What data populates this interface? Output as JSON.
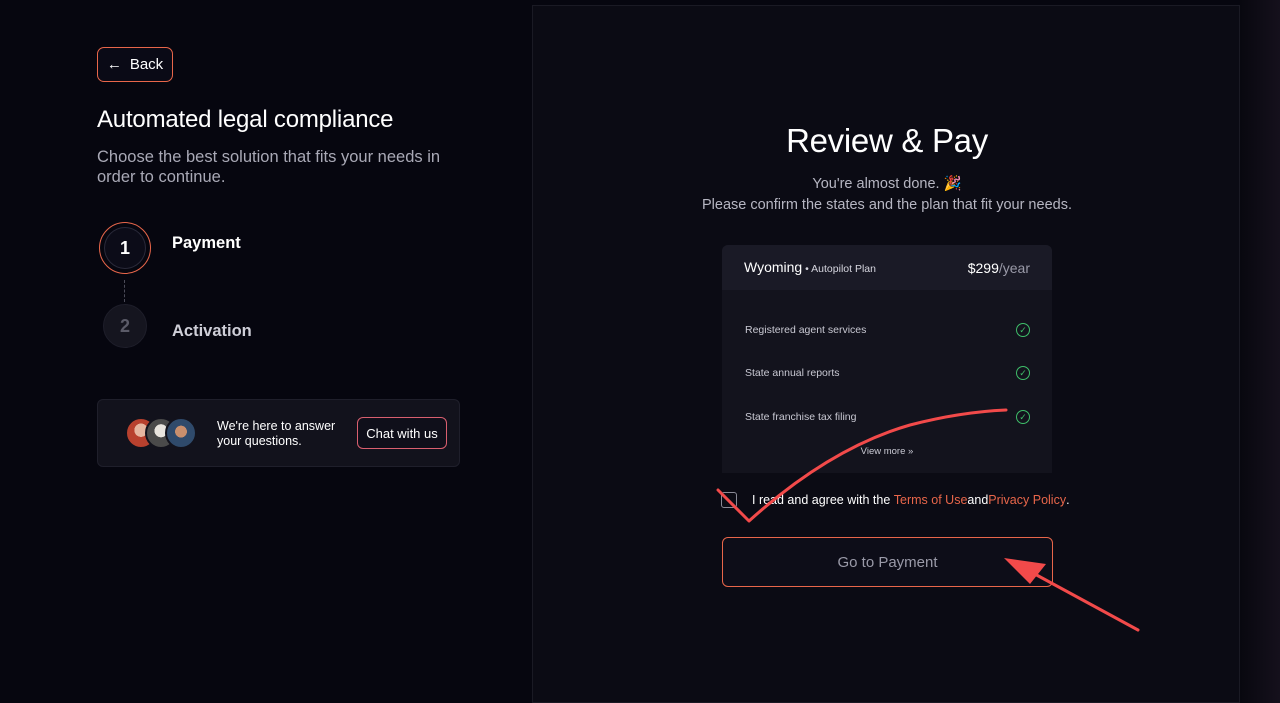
{
  "left": {
    "back_label": "Back",
    "title": "Automated legal compliance",
    "subtitle": "Choose the best solution that fits your needs in order to continue.",
    "steps": [
      {
        "number": "1",
        "label": "Payment",
        "active": true
      },
      {
        "number": "2",
        "label": "Activation",
        "active": false
      }
    ],
    "help": {
      "text": "We're here to answer your questions.",
      "chat_label": "Chat with us"
    }
  },
  "review": {
    "title": "Review & Pay",
    "subtitle1": "You're almost done. 🎉",
    "subtitle2": "Please confirm the states and the plan that fit your needs.",
    "plan": {
      "state": "Wyoming",
      "separator": " • ",
      "plan_name": "Autopilot Plan",
      "price": "$299",
      "period": "/year",
      "features": [
        "Registered agent services",
        "State annual reports",
        "State franchise tax filing"
      ],
      "more_label": "View more"
    },
    "agree": {
      "prefix": "I read and agree with the ",
      "terms": "Terms of Use",
      "and": " and ",
      "privacy": "Privacy Policy",
      "suffix": "."
    },
    "pay_label": "Go to Payment"
  },
  "colors": {
    "accent": "#e8664a",
    "success": "#3fbf6a",
    "background": "#06060f",
    "annotation": "#f24a4a"
  }
}
